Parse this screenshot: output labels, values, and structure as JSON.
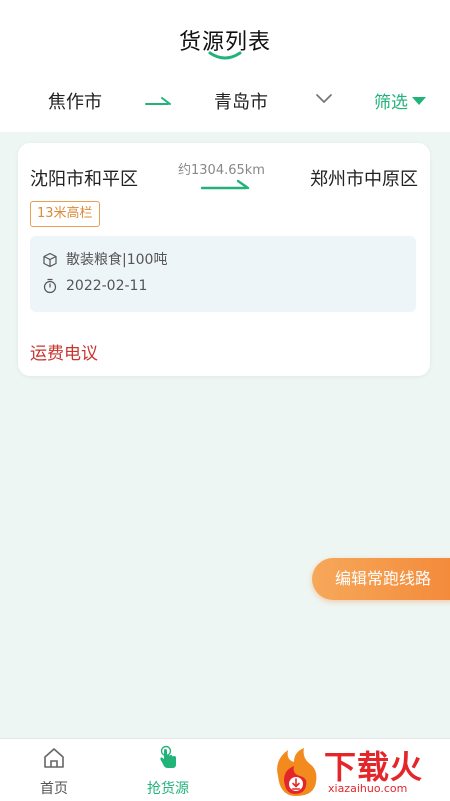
{
  "header": {
    "title": "货源列表",
    "from_city": "焦作市",
    "to_city": "青岛市",
    "filter_label": "筛选"
  },
  "cards": [
    {
      "start": "沈阳市和平区",
      "distance": "约1304.65km",
      "end": "郑州市中原区",
      "tag": "13米高栏",
      "cargo": "散装粮食|100吨",
      "date": "2022-02-11",
      "price": "运费电议"
    }
  ],
  "fab": {
    "label": "编辑常跑线路"
  },
  "tabbar": {
    "items": [
      {
        "label": "首页",
        "icon": "home-icon"
      },
      {
        "label": "抢货源",
        "icon": "hand-tap-icon"
      }
    ]
  },
  "watermark": {
    "text": "下载火",
    "url": "xiazaihuo.com"
  },
  "colors": {
    "accent": "#22b37b",
    "price": "#c8362f",
    "tag": "#d98a3a",
    "fab": "#f38a3a",
    "background": "#eef6f3"
  }
}
